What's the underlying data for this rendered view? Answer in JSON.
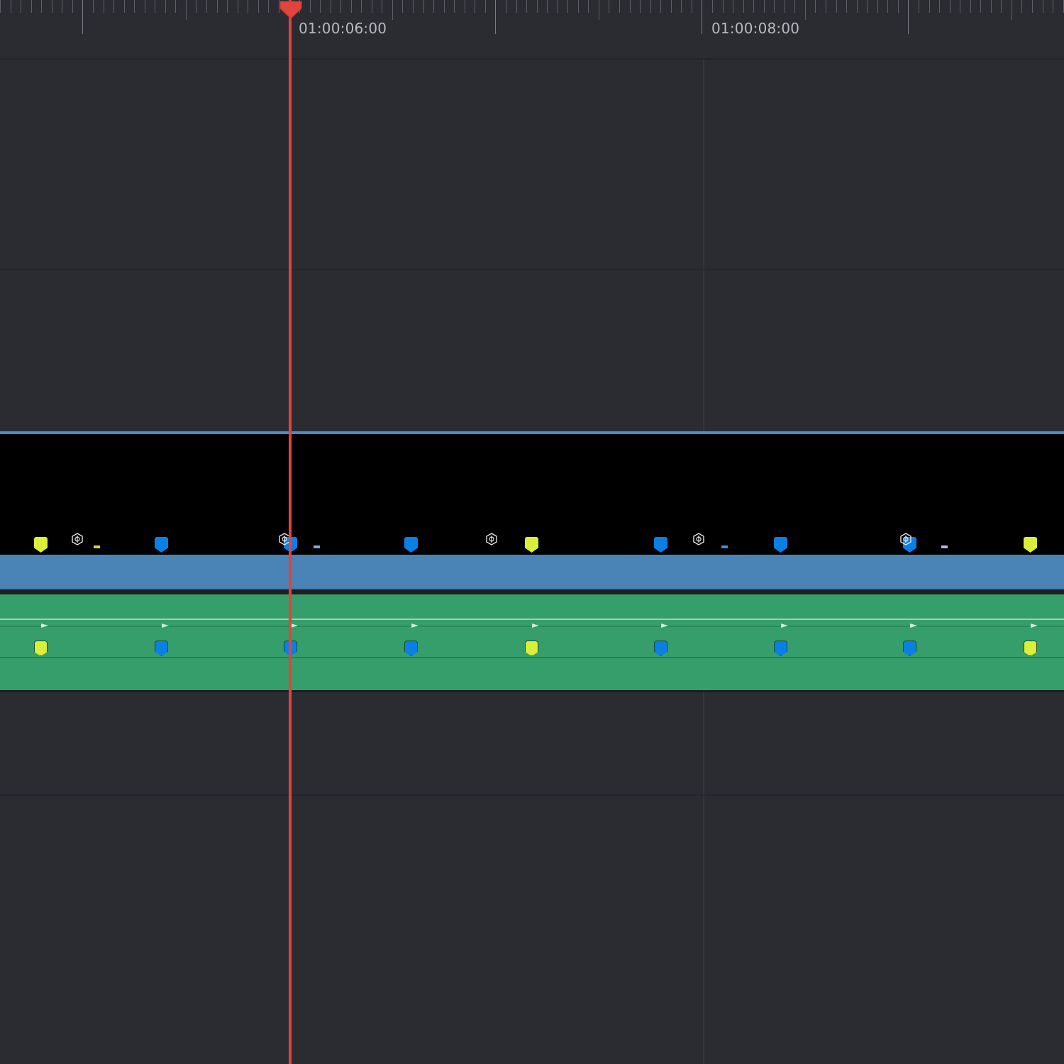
{
  "timeline": {
    "ruler": {
      "labels": [
        "01:00:06:00",
        "01:00:08:00"
      ]
    },
    "tracks": {
      "video": {
        "marker_colors": [
          "yellow",
          "blue",
          "blue",
          "blue",
          "yellow",
          "blue",
          "blue",
          "blue",
          "yellow"
        ]
      },
      "audio": {
        "marker_colors": [
          "yellow",
          "blue",
          "blue",
          "blue",
          "yellow",
          "blue",
          "blue",
          "blue",
          "yellow"
        ]
      }
    },
    "colors": {
      "playhead": "#e0443c",
      "video_clip": "#4a83b5",
      "audio_clip": "#369e6a",
      "marker_yellow": "#dbef3a",
      "marker_blue": "#0a7fe6",
      "background": "#2b2c32"
    },
    "icons": [
      "playhead-icon",
      "keyframe-icon",
      "marker-icon"
    ]
  }
}
